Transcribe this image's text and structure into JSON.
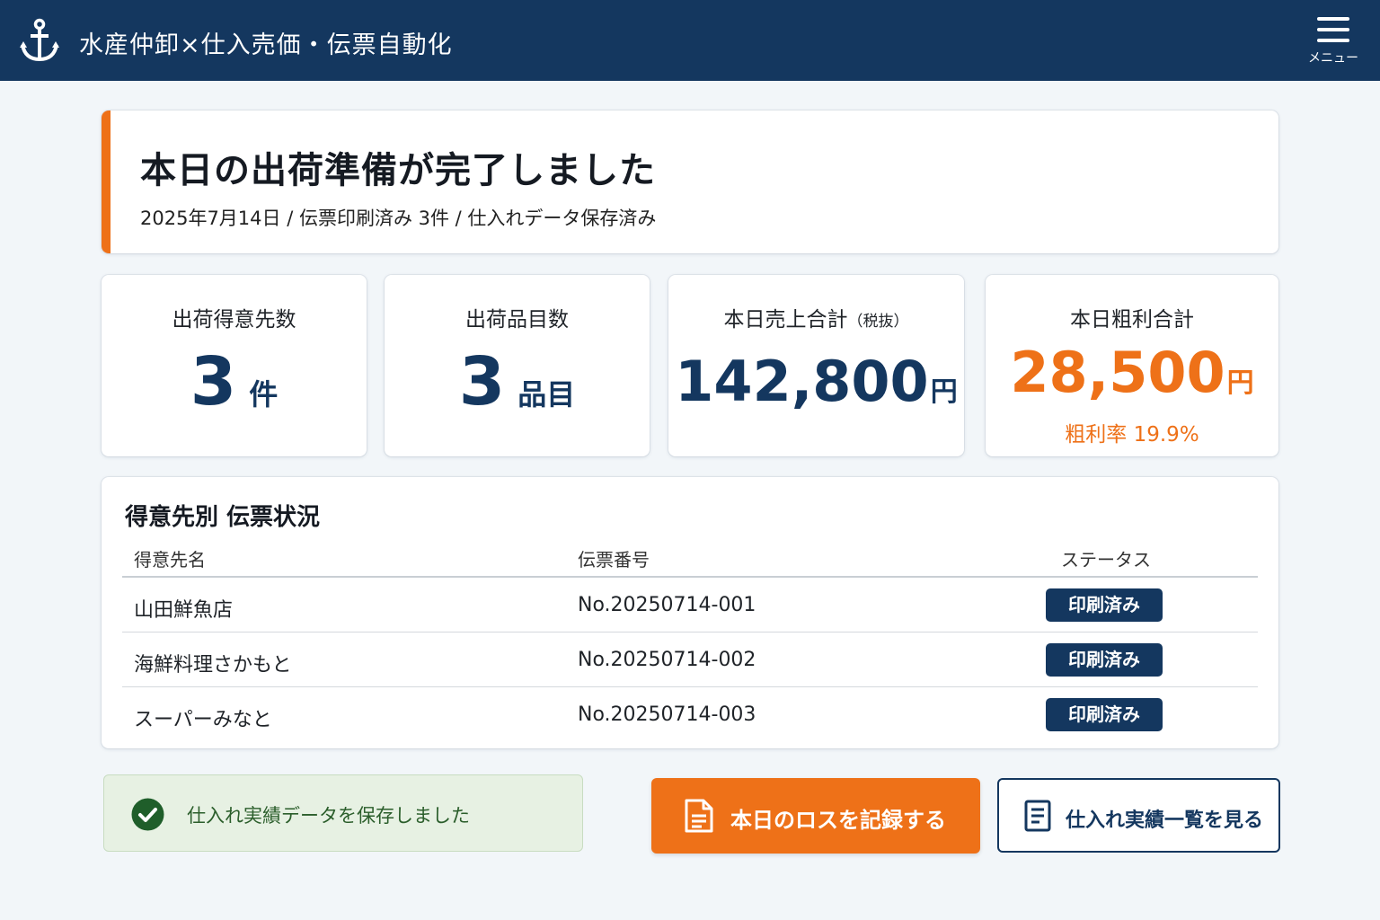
{
  "header": {
    "title": "水産仲卸×仕入売価・伝票自動化",
    "menu_label": "メニュー"
  },
  "icons": {
    "logo": "anchor-icon",
    "menu": "hamburger-icon",
    "success": "check-circle-icon",
    "record_loss": "document-icon",
    "purchase_list": "list-document-icon"
  },
  "colors": {
    "brand": "#14375f",
    "accent": "#ee7118",
    "success_bg": "#e7f1e3",
    "success_icon": "#1f5e2a"
  },
  "banner": {
    "title": "本日の出荷準備が完了しました",
    "subtitle": "2025年7月14日 / 伝票印刷済み 3件 / 仕入れデータ保存済み"
  },
  "stats": {
    "customers": {
      "label": "出荷得意先数",
      "value": "3",
      "unit": "件"
    },
    "items": {
      "label": "出荷品目数",
      "value": "3",
      "unit": "品目"
    },
    "sales": {
      "label": "本日売上合計",
      "label_note": "（税抜）",
      "value": "142,800",
      "unit": "円"
    },
    "profit": {
      "label": "本日粗利合計",
      "value": "28,500",
      "unit": "円",
      "margin": "粗利率 19.9%"
    }
  },
  "table": {
    "title": "得意先別 伝票状況",
    "headers": {
      "customer": "得意先名",
      "slip": "伝票番号",
      "status": "ステータス"
    },
    "rows": [
      {
        "customer": "山田鮮魚店",
        "slip": "No.20250714-001",
        "status": "印刷済み"
      },
      {
        "customer": "海鮮料理さかもと",
        "slip": "No.20250714-002",
        "status": "印刷済み"
      },
      {
        "customer": "スーパーみなと",
        "slip": "No.20250714-003",
        "status": "印刷済み"
      }
    ]
  },
  "notice": {
    "text": "仕入れ実績データを保存しました"
  },
  "actions": {
    "record_loss": "本日のロスを記録する",
    "purchase_list": "仕入れ実績一覧を見る"
  }
}
